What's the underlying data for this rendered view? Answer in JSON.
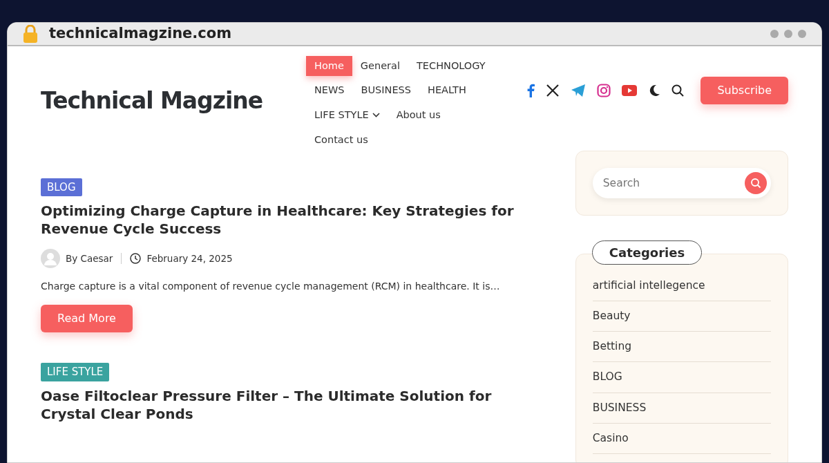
{
  "browser": {
    "url": "technicalmagzine.com"
  },
  "site": {
    "title": "Technical Magzine"
  },
  "nav": [
    {
      "label": "Home",
      "selected": true,
      "has_dropdown": false
    },
    {
      "label": "General",
      "selected": false,
      "has_dropdown": false
    },
    {
      "label": "TECHNOLOGY",
      "selected": false,
      "has_dropdown": false
    },
    {
      "label": "NEWS",
      "selected": false,
      "has_dropdown": false
    },
    {
      "label": "BUSINESS",
      "selected": false,
      "has_dropdown": false
    },
    {
      "label": "HEALTH",
      "selected": false,
      "has_dropdown": false
    },
    {
      "label": "LIFE STYLE",
      "selected": false,
      "has_dropdown": true
    },
    {
      "label": "About us",
      "selected": false,
      "has_dropdown": false
    },
    {
      "label": "Contact us",
      "selected": false,
      "has_dropdown": false
    }
  ],
  "subscribe_button": "Subscribe",
  "posts": [
    {
      "tag": {
        "label": "BLOG",
        "color": "#5b6fd6"
      },
      "title": "Optimizing Charge Capture in Healthcare: Key Strategies for Revenue Cycle Success",
      "author": "By Caesar",
      "date": "February 24, 2025",
      "excerpt": "Charge capture is a vital component of revenue cycle management (RCM) in healthcare. It is…",
      "button": "Read More"
    },
    {
      "tag": {
        "label": "LIFE STYLE",
        "color": "#3aa39f"
      },
      "title": "Oase Filtoclear Pressure Filter – The Ultimate Solution for Crystal Clear Ponds"
    }
  ],
  "sidebar": {
    "search": {
      "placeholder": "Search"
    },
    "categories": {
      "title": "Categories",
      "items": [
        "artificial intellegence",
        "Beauty",
        "Betting",
        "BLOG",
        "BUSINESS",
        "Casino"
      ]
    }
  }
}
